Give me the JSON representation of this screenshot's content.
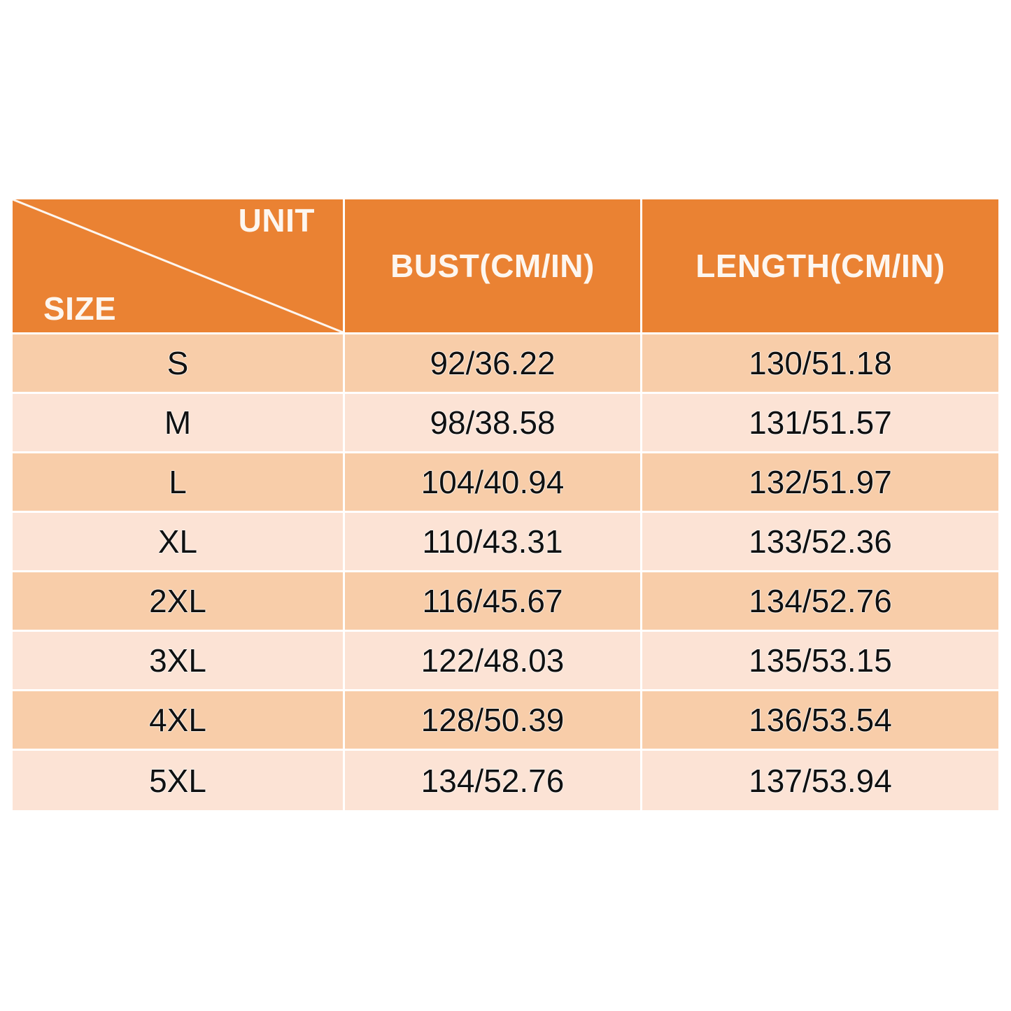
{
  "chart": {
    "header": {
      "corner": {
        "unit_label": "UNIT",
        "size_label": "SIZE"
      },
      "columns": [
        "BUST(CM/IN)",
        "LENGTH(CM/IN)"
      ]
    },
    "rows": [
      {
        "size": "S",
        "bust": "92/36.22",
        "length": "130/51.18"
      },
      {
        "size": "M",
        "bust": "98/38.58",
        "length": "131/51.57"
      },
      {
        "size": "L",
        "bust": "104/40.94",
        "length": "132/51.97"
      },
      {
        "size": "XL",
        "bust": "110/43.31",
        "length": "133/52.36"
      },
      {
        "size": "2XL",
        "bust": "116/45.67",
        "length": "134/52.76"
      },
      {
        "size": "3XL",
        "bust": "122/48.03",
        "length": "135/53.15"
      },
      {
        "size": "4XL",
        "bust": "128/50.39",
        "length": "136/53.54"
      },
      {
        "size": "5XL",
        "bust": "134/52.76",
        "length": "137/53.94"
      }
    ],
    "colors": {
      "header_background": "#ea8233",
      "header_text": "#fdf6ef",
      "row_odd_background": "#f8cda9",
      "row_even_background": "#fce3d5",
      "row_text": "#111111",
      "grid_line": "#ffffff",
      "page_background": "#ffffff"
    }
  },
  "chart_data": {
    "type": "table",
    "title": "",
    "columns": [
      "SIZE",
      "BUST(CM/IN)",
      "LENGTH(CM/IN)"
    ],
    "rows": [
      [
        "S",
        "92/36.22",
        "130/51.18"
      ],
      [
        "M",
        "98/38.58",
        "131/51.57"
      ],
      [
        "L",
        "104/40.94",
        "132/51.97"
      ],
      [
        "XL",
        "110/43.31",
        "133/52.36"
      ],
      [
        "2XL",
        "116/45.67",
        "134/52.76"
      ],
      [
        "3XL",
        "122/48.03",
        "135/53.15"
      ],
      [
        "4XL",
        "128/50.39",
        "136/53.54"
      ],
      [
        "5XL",
        "134/52.76",
        "137/53.94"
      ]
    ],
    "bust_cm": [
      92,
      98,
      104,
      110,
      116,
      122,
      128,
      134
    ],
    "bust_in": [
      36.22,
      38.58,
      40.94,
      43.31,
      45.67,
      48.03,
      50.39,
      52.76
    ],
    "length_cm": [
      130,
      131,
      132,
      133,
      134,
      135,
      136,
      137
    ],
    "length_in": [
      51.18,
      51.57,
      51.97,
      52.36,
      52.76,
      53.15,
      53.54,
      53.94
    ]
  }
}
